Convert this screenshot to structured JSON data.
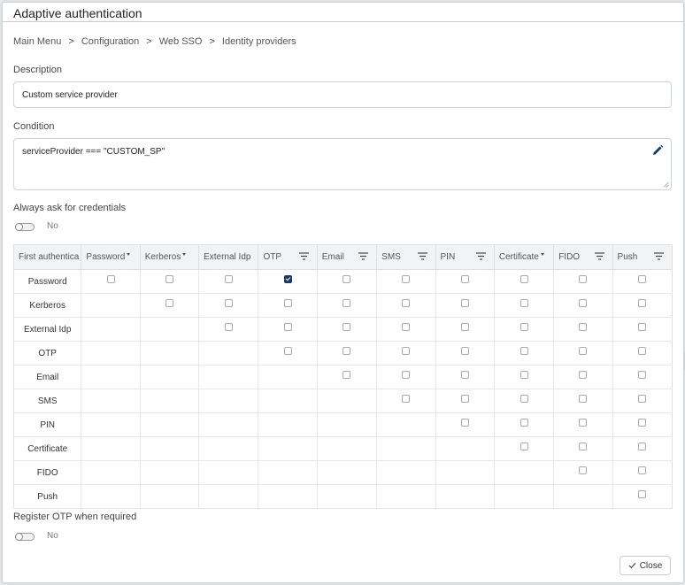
{
  "dialog": {
    "title": "Adaptive authentication"
  },
  "breadcrumb": [
    "Main Menu",
    "Configuration",
    "Web SSO",
    "Identity providers"
  ],
  "breadcrumb_separator": ">",
  "description": {
    "label": "Description",
    "value": "Custom service provider"
  },
  "condition": {
    "label": "Condition",
    "value": "serviceProvider === \"CUSTOM_SP\"",
    "edit_icon": "pencil-icon"
  },
  "always_ask": {
    "label": "Always ask for credentials",
    "state": "No",
    "on": false
  },
  "grid": {
    "columns": [
      {
        "label": "First authentica",
        "control": "none"
      },
      {
        "label": "Password",
        "control": "caret"
      },
      {
        "label": "Kerberos",
        "control": "caret"
      },
      {
        "label": "External Idp",
        "control": "none"
      },
      {
        "label": "OTP",
        "control": "filter"
      },
      {
        "label": "Email",
        "control": "filter"
      },
      {
        "label": "SMS",
        "control": "filter"
      },
      {
        "label": "PIN",
        "control": "filter"
      },
      {
        "label": "Certificate",
        "control": "caret"
      },
      {
        "label": "FIDO",
        "control": "filter"
      },
      {
        "label": "Push",
        "control": "filter"
      }
    ],
    "rows": [
      {
        "label": "Password",
        "checks": [
          0,
          0,
          0,
          1,
          0,
          0,
          0,
          0,
          0,
          0
        ]
      },
      {
        "label": "Kerberos",
        "checks": [
          null,
          0,
          0,
          0,
          0,
          0,
          0,
          0,
          0,
          0
        ]
      },
      {
        "label": "External Idp",
        "checks": [
          null,
          null,
          0,
          0,
          0,
          0,
          0,
          0,
          0,
          0
        ]
      },
      {
        "label": "OTP",
        "checks": [
          null,
          null,
          null,
          0,
          0,
          0,
          0,
          0,
          0,
          0
        ]
      },
      {
        "label": "Email",
        "checks": [
          null,
          null,
          null,
          null,
          0,
          0,
          0,
          0,
          0,
          0
        ]
      },
      {
        "label": "SMS",
        "checks": [
          null,
          null,
          null,
          null,
          null,
          0,
          0,
          0,
          0,
          0
        ]
      },
      {
        "label": "PIN",
        "checks": [
          null,
          null,
          null,
          null,
          null,
          null,
          0,
          0,
          0,
          0
        ]
      },
      {
        "label": "Certificate",
        "checks": [
          null,
          null,
          null,
          null,
          null,
          null,
          null,
          0,
          0,
          0
        ]
      },
      {
        "label": "FIDO",
        "checks": [
          null,
          null,
          null,
          null,
          null,
          null,
          null,
          null,
          0,
          0
        ]
      },
      {
        "label": "Push",
        "checks": [
          null,
          null,
          null,
          null,
          null,
          null,
          null,
          null,
          null,
          0
        ]
      }
    ]
  },
  "register_otp": {
    "label": "Register OTP when required",
    "state": "No",
    "on": false
  },
  "footer": {
    "close_label": "Close",
    "close_icon": "check-icon"
  },
  "colors": {
    "checked": "#1a3a63",
    "header_bg": "#f2f3f4",
    "accent": "#1a3a63"
  }
}
